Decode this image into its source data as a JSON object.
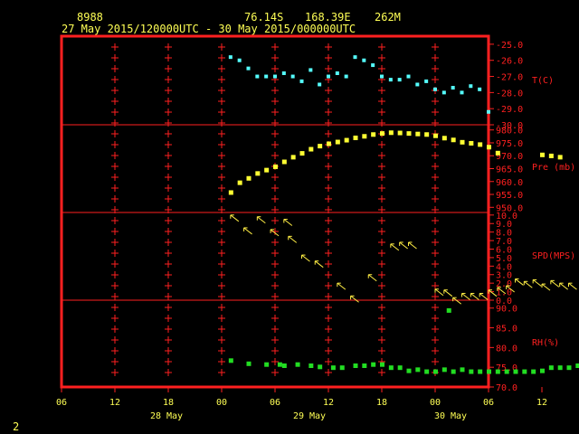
{
  "header": {
    "station_id": "8988",
    "lat": "76.14S",
    "lon": "168.39E",
    "elev": "262M",
    "period": "27 May 2015/120000UTC - 30 May 2015/000000UTC"
  },
  "footer_label": "2",
  "colors": {
    "text": "#ffff55",
    "frame": "#ff2020",
    "temp": "#55ffff",
    "pressure": "#ffff33",
    "wind": "#ffee44",
    "rh": "#22dd22"
  },
  "chart_data": {
    "type": "multi-panel time series",
    "x_tick_labels": [
      "06",
      "12",
      "18",
      "00",
      "06",
      "12",
      "18",
      "00",
      "06",
      "12",
      "18",
      "00",
      "06"
    ],
    "x_day_labels": [
      "28 May",
      "29 May",
      "30 May"
    ],
    "x_range_hours": [
      -6,
      42
    ],
    "panels": [
      {
        "name": "temperature",
        "label": "T(C)",
        "ylim": [
          -30,
          -24.5
        ],
        "tick_labels": [
          "-25.0",
          "-26.0",
          "-27.0",
          "-28.0",
          "-29.0",
          "-30.0"
        ],
        "tick_values": [
          -25,
          -26,
          -27,
          -28,
          -29,
          -30
        ],
        "x": [
          13,
          15,
          17,
          18,
          19,
          20.5,
          21,
          22,
          24,
          25,
          27,
          28,
          29,
          30,
          32,
          32.5,
          33,
          34,
          36,
          37,
          38,
          39,
          40,
          41,
          42,
          43,
          44,
          45,
          46,
          47.5,
          48,
          49,
          50,
          51,
          53,
          54,
          55,
          55.5,
          56,
          58,
          60,
          60.2,
          61,
          61.5,
          62,
          64,
          66,
          67,
          68
        ],
        "y": [
          -25.8,
          -26.0,
          -26.5,
          -27.0,
          -27.0,
          -27.0,
          -26.8,
          -27.0,
          -27.3,
          -26.6,
          -27.5,
          -27.0,
          -26.8,
          -27.0,
          -25.8,
          -26.0,
          -26.3,
          -27.0,
          -27.2,
          -27.2,
          -27.0,
          -27.5,
          -27.3,
          -27.8,
          -28.0,
          -27.7,
          -28.0,
          -27.6,
          -27.8,
          -29.2,
          -29.5,
          -29.8,
          -28.8,
          -29.0,
          -29.4,
          -28.5,
          -28.0,
          -27.8,
          -28.0,
          -28.5,
          -27.5,
          -27.8,
          -27.3,
          -27.0,
          -27.5,
          -27.0,
          -26.2,
          -25.5,
          -25.6
        ],
        "x_hours": [
          13,
          14,
          15,
          16,
          17,
          18,
          19,
          20,
          21,
          22,
          23,
          24,
          25,
          26,
          27,
          28,
          29,
          30,
          31,
          32,
          33,
          34,
          35,
          36,
          37,
          38,
          39,
          40,
          41,
          42
        ],
        "values": [
          -25.8,
          -26.0,
          -26.5,
          -27.0,
          -27.0,
          -27.0,
          -26.8,
          -27.0,
          -27.3,
          -26.6,
          -27.5,
          -27.0,
          -26.8,
          -27.0,
          -25.8,
          -26.0,
          -26.3,
          -27.0,
          -27.2,
          -27.2,
          -27.0,
          -27.5,
          -27.3,
          -27.8,
          -28.0,
          -27.7,
          -28.0,
          -27.6,
          -27.8,
          -29.2
        ]
      },
      {
        "name": "pressure",
        "label": "Pre (mb)",
        "ylim": [
          948,
          982
        ],
        "tick_labels": [
          "980.0",
          "975.0",
          "970.0",
          "965.0",
          "960.0",
          "955.0",
          "950.0"
        ],
        "tick_values": [
          980,
          975,
          970,
          965,
          960,
          955,
          950
        ],
        "x": [
          0,
          3,
          6,
          9,
          12,
          15,
          18,
          21,
          24,
          27,
          30,
          33,
          36,
          39,
          42,
          45,
          48,
          51,
          54,
          57,
          60,
          63,
          66,
          69,
          72,
          75,
          78,
          81,
          84,
          87,
          93,
          96,
          99,
          102,
          105,
          108,
          111,
          114,
          117,
          120,
          123,
          126,
          129,
          132,
          138,
          141,
          144,
          147
        ],
        "y": [
          955.9,
          959.7,
          961.4,
          963.3,
          964.6,
          965.9,
          967.8,
          969.6,
          971.1,
          972.7,
          973.9,
          974.8,
          975.5,
          976.2,
          977.1,
          977.7,
          978.4,
          978.8,
          979.1,
          979.0,
          978.8,
          978.6,
          978.4,
          977.9,
          977.0,
          976.3,
          975.4,
          975.0,
          974.5,
          973.5,
          971.2,
          970.5,
          970.1,
          969.6
        ]
      },
      {
        "name": "wind",
        "label": "SPD(MPS)",
        "ylim": [
          0,
          10.3
        ],
        "tick_labels": [
          "10.0",
          "9.0",
          "8.0",
          "7.0",
          "6.0",
          "5.0",
          "4.0",
          "3.0",
          "2.0",
          "1.0",
          "0.0"
        ],
        "tick_values": [
          10,
          9,
          8,
          7,
          6,
          5,
          4,
          3,
          2,
          1,
          0
        ],
        "x": [
          0,
          3,
          6,
          9,
          12,
          15,
          18,
          21,
          24,
          27,
          30,
          33,
          36,
          39,
          42,
          45,
          48,
          51,
          54,
          57,
          60,
          63,
          66,
          69,
          72,
          75,
          78,
          81,
          84,
          87,
          93,
          96,
          99,
          102,
          105,
          108,
          111,
          114,
          117,
          120,
          123,
          126,
          129,
          132,
          138,
          141,
          144,
          147
        ],
        "y": [
          10.0,
          8.5,
          9.8,
          8.3,
          9.5,
          7.5,
          5.3,
          4.6,
          2.0,
          0.5,
          3.0,
          6.6,
          6.8,
          6.8,
          1.3,
          1.2,
          0.3,
          0.8,
          0.8,
          0.8,
          1.2,
          1.5,
          1.7,
          2.5,
          2.2,
          2.4,
          1.9,
          2.3,
          2.0,
          2.0,
          1.3,
          1.0,
          1.0,
          0.8
        ],
        "hours": [
          13,
          14.5,
          16,
          17.5,
          19,
          19.5,
          21,
          22.5,
          25,
          26.5,
          28.5,
          31,
          32,
          33,
          36,
          37,
          38,
          39,
          40,
          41,
          42,
          43,
          44,
          45,
          46,
          47,
          48,
          49,
          50,
          51,
          53,
          54,
          55.5,
          57
        ],
        "speeds": [
          10.0,
          8.5,
          9.8,
          8.3,
          9.5,
          7.5,
          5.3,
          4.6,
          2.0,
          0.5,
          3.0,
          6.6,
          6.8,
          6.8,
          1.3,
          1.2,
          0.3,
          0.8,
          0.8,
          0.8,
          1.2,
          1.5,
          1.7,
          2.5,
          2.2,
          2.4,
          1.9,
          2.3,
          2.0,
          2.0,
          1.3,
          1.0,
          1.0,
          0.8
        ]
      },
      {
        "name": "relative humidity",
        "label": "RH(%)",
        "ylim": [
          70,
          92
        ],
        "tick_labels": [
          "90.0",
          "85.0",
          "80.0",
          "75.0",
          "70.0"
        ],
        "tick_values": [
          90,
          85,
          80,
          75,
          70
        ],
        "x_hours": [
          13,
          15,
          17,
          18.5,
          19,
          20.5,
          22,
          23,
          24.5,
          25.5,
          27,
          28,
          29,
          30,
          31,
          32,
          33,
          34,
          35,
          36,
          37,
          38,
          39,
          40,
          41,
          42,
          43,
          44,
          45,
          46,
          47,
          48,
          49,
          50,
          51,
          52,
          53,
          54,
          55,
          56,
          57,
          58,
          59,
          60,
          61,
          62,
          64,
          66,
          68,
          37.5
        ],
        "values": [
          76.8,
          76.0,
          75.8,
          75.8,
          75.5,
          75.8,
          75.5,
          75.2,
          75.0,
          75.0,
          75.5,
          75.5,
          75.8,
          75.8,
          75.0,
          75.0,
          74.2,
          74.5,
          74.0,
          74.0,
          74.5,
          74.0,
          74.5,
          74.0,
          74.0,
          74.0,
          74.0,
          74.0,
          74.0,
          74.0,
          74.0,
          74.2,
          75.0,
          75.0,
          75.0,
          75.5,
          75.5,
          75.5,
          75.0,
          75.5,
          75.8,
          75.8,
          76.0,
          75.5,
          75.5,
          75.5,
          76.0,
          75.8,
          75.8,
          89.5
        ]
      }
    ]
  }
}
